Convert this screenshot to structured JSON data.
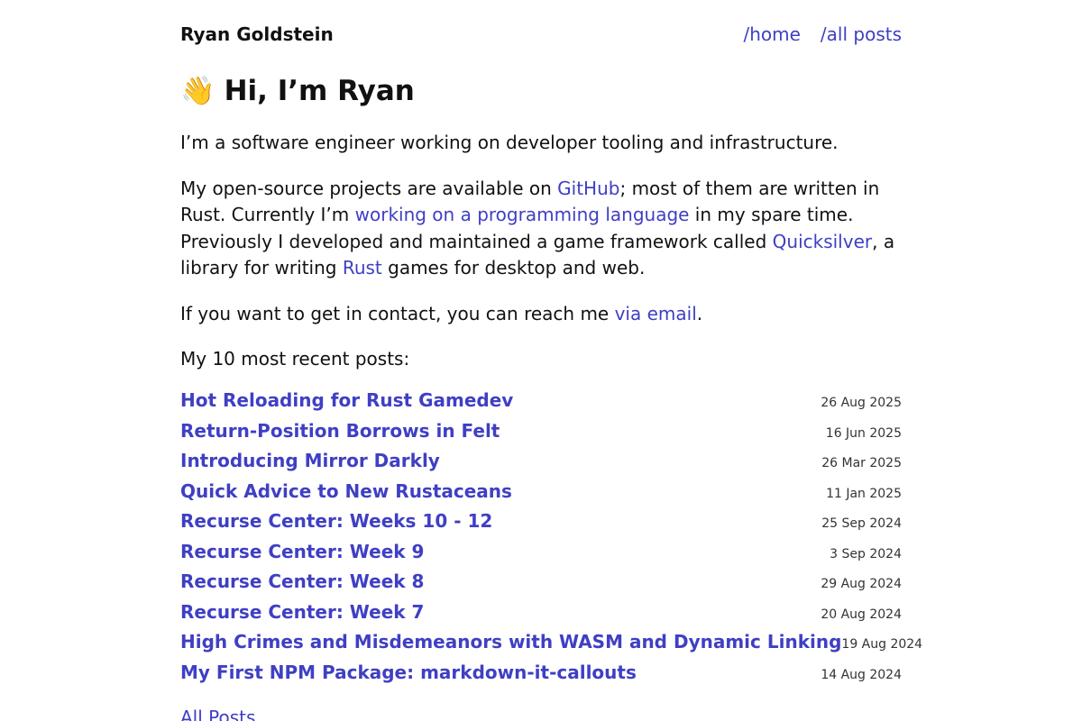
{
  "header": {
    "site_title": "Ryan Goldstein",
    "nav": [
      "/home",
      "/all posts"
    ]
  },
  "hero": {
    "emoji": "👋",
    "heading": "Hi, I’m Ryan"
  },
  "intro": {
    "p1": "I’m a software engineer working on developer tooling and infrastructure.",
    "p2_a": "My open-source projects are available on ",
    "p2_link_github": "GitHub",
    "p2_b": "; most of them are written in Rust. Currently I’m ",
    "p2_link_lang": "working on a programming language",
    "p2_c": " in my spare time. Previously I developed and maintained a game framework called ",
    "p2_link_quicksilver": "Quicksilver",
    "p2_d": ", a library for writing ",
    "p2_link_rust": "Rust",
    "p2_e": " games for desktop and web.",
    "p3_a": "If you want to get in contact, you can reach me ",
    "p3_link_email": "via email",
    "p3_b": ".",
    "recent_label": "My 10 most recent posts:"
  },
  "posts": [
    {
      "title": "Hot Reloading for Rust Gamedev",
      "date": "26 Aug 2025"
    },
    {
      "title": "Return-Position Borrows in Felt",
      "date": "16 Jun 2025"
    },
    {
      "title": "Introducing Mirror Darkly",
      "date": "26 Mar 2025"
    },
    {
      "title": "Quick Advice to New Rustaceans",
      "date": "11 Jan 2025"
    },
    {
      "title": "Recurse Center: Weeks 10 - 12",
      "date": "25 Sep 2024"
    },
    {
      "title": "Recurse Center: Week 9",
      "date": "3 Sep 2024"
    },
    {
      "title": "Recurse Center: Week 8",
      "date": "29 Aug 2024"
    },
    {
      "title": "Recurse Center: Week 7",
      "date": "20 Aug 2024"
    },
    {
      "title": "High Crimes and Misdemeanors with WASM and Dynamic Linking",
      "date": "19 Aug 2024"
    },
    {
      "title": "My First NPM Package: markdown-it-callouts",
      "date": "14 Aug 2024"
    }
  ],
  "footer": {
    "all_posts_link": "All Posts"
  },
  "colors": {
    "link": "#3f3fc4",
    "text": "#111111"
  }
}
